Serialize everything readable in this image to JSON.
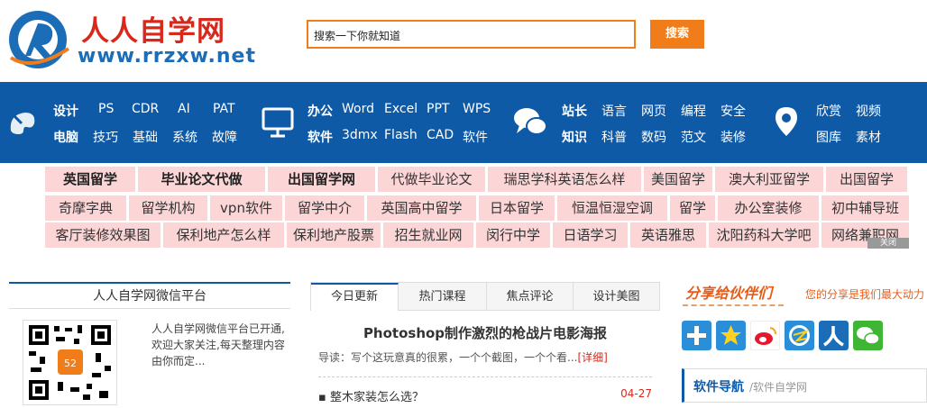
{
  "brand": {
    "name_cn": "人人自学网",
    "domain": "www.rrzxw.net"
  },
  "search": {
    "value": "搜索一下你就知道",
    "button": "搜索"
  },
  "nav": {
    "groups": [
      {
        "icon": "design-icon",
        "row1": [
          "设计",
          "PS",
          "CDR",
          "AI",
          "PAT"
        ],
        "row2": [
          "电脑",
          "技巧",
          "基础",
          "系统",
          "故障"
        ]
      },
      {
        "icon": "office-icon",
        "row1": [
          "办公",
          "Word",
          "Excel",
          "PPT",
          "WPS"
        ],
        "row2": [
          "软件",
          "3dmx",
          "Flash",
          "CAD",
          "软件"
        ]
      },
      {
        "icon": "chat-icon",
        "row1": [
          "站长",
          "语言",
          "网页",
          "编程",
          "安全"
        ],
        "row2": [
          "知识",
          "科普",
          "数码",
          "范文",
          "装修"
        ]
      },
      {
        "icon": "location-icon",
        "row1": [
          "欣赏",
          "视频"
        ],
        "row2": [
          "图库",
          "素材"
        ]
      }
    ]
  },
  "links": {
    "row1": [
      "英国留学",
      "毕业论文代做",
      "出国留学网",
      "代做毕业论文",
      "瑞思学科英语怎么样",
      "美国留学",
      "澳大利亚留学",
      "出国留学"
    ],
    "row2": [
      "奇摩字典",
      "留学机构",
      "vpn软件",
      "留学中介",
      "英国高中留学",
      "日本留学",
      "恒温恒湿空调",
      "留学",
      "办公室装修",
      "初中辅导班"
    ],
    "row3": [
      "客厅装修效果图",
      "保利地产怎么样",
      "保利地产股票",
      "招生就业网",
      "闵行中学",
      "日语学习",
      "英语雅思",
      "沈阳药科大学吧",
      "网络兼职网"
    ],
    "close_label": "关闭"
  },
  "wechat": {
    "title": "人人自学网微信平台",
    "desc": "人人自学网微信平台已开通,欢迎大家关注,每天整理内容由你而定..."
  },
  "news": {
    "tabs": [
      "今日更新",
      "热门课程",
      "焦点评论",
      "设计美图"
    ],
    "headline": "Photoshop制作激烈的枪战片电影海报",
    "lead": "导读：写个这玩意真的很累，一个个截图，一个个看...",
    "more": "[详细]",
    "items": [
      {
        "title": "整木家装怎么选？",
        "date": "04-27"
      }
    ]
  },
  "share": {
    "title": "分享给伙伴们",
    "subtitle": "您的分享是我们最大动力",
    "icons": [
      "plus-share-icon",
      "star-share-icon",
      "weibo-icon",
      "qzone-icon",
      "renren-icon",
      "wechat-icon"
    ],
    "colors": {
      "brand_blue": "#0e5aa7",
      "accent_orange": "#f07d1a",
      "link_pink": "#fcd5d7"
    }
  },
  "software_nav": {
    "title": "软件导航",
    "sub": "/软件自学网"
  }
}
